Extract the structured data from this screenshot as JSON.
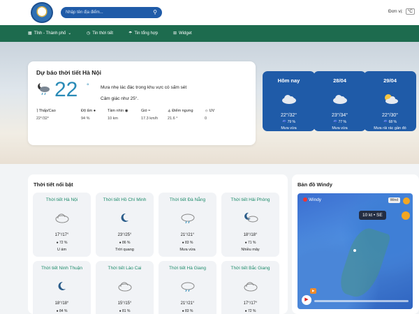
{
  "header": {
    "search_placeholder": "Nhập tên địa điểm...",
    "unit_label": "Đơn vị:",
    "unit_value": "°C"
  },
  "nav": [
    {
      "label": "Tỉnh - Thành phố",
      "icon": "building-icon"
    },
    {
      "label": "Tin thời tiết",
      "icon": "clock-icon"
    },
    {
      "label": "Tin tổng hợp",
      "icon": "umbrella-icon"
    },
    {
      "label": "Widget",
      "icon": "widget-icon"
    }
  ],
  "forecast": {
    "title": "Dự báo thời tiết Hà Nội",
    "temp": "22",
    "unit": "°",
    "desc": "Mưa nhẹ lác đác trong khu vực có sấm sét",
    "feels": "Cảm giác như 25°.",
    "stats": [
      {
        "label": "Thấp/Cao",
        "value": "22°/32°"
      },
      {
        "label": "Độ ẩm",
        "value": "94 %"
      },
      {
        "label": "Tầm nhìn",
        "value": "10 km"
      },
      {
        "label": "Gió",
        "value": "17.3 km/h"
      },
      {
        "label": "Điểm ngưng",
        "value": "21.6 °"
      },
      {
        "label": "UV",
        "value": "0"
      }
    ]
  },
  "days": [
    {
      "label": "Hôm nay",
      "temp": "22°/32°",
      "rain": "☔ 79 %",
      "summary": "Mưa vừa",
      "icon": "cloud-icon"
    },
    {
      "label": "28/04",
      "temp": "23°/34°",
      "rain": "☔ 77 %",
      "summary": "Mưa vừa",
      "icon": "cloud-icon"
    },
    {
      "label": "29/04",
      "temp": "22°/30°",
      "rain": "☔ 68 %",
      "summary": "Mưa rải rác gần đó",
      "icon": "sun-cloud-icon"
    }
  ],
  "featured": {
    "title": "Thời tiết nổi bật",
    "cities": [
      {
        "name": "Thời tiết Hà Nội",
        "temp": "17°/17°",
        "rain": "72 %",
        "summary": "U ám",
        "icon": "cloud-icon"
      },
      {
        "name": "Thời tiết Hồ Chí Minh",
        "temp": "23°/25°",
        "rain": "86 %",
        "summary": "Trời quang",
        "icon": "moon-icon"
      },
      {
        "name": "Thời tiết Đà Nẵng",
        "temp": "21°/21°",
        "rain": "83 %",
        "summary": "Mưa vừa",
        "icon": "rain-cloud-icon"
      },
      {
        "name": "Thời tiết Hải Phòng",
        "temp": "18°/18°",
        "rain": "71 %",
        "summary": "Nhiều mây",
        "icon": "moon-cloud-icon"
      },
      {
        "name": "Thời tiết Ninh Thuận",
        "temp": "18°/18°",
        "rain": "84 %",
        "summary": "",
        "icon": "moon-icon"
      },
      {
        "name": "Thời tiết Lào Cai",
        "temp": "15°/15°",
        "rain": "81 %",
        "summary": "",
        "icon": "cloud-icon"
      },
      {
        "name": "Thời tiết Hà Giang",
        "temp": "21°/21°",
        "rain": "83 %",
        "summary": "",
        "icon": "rain-cloud-icon"
      },
      {
        "name": "Thời tiết Bắc Giang",
        "temp": "17°/17°",
        "rain": "72 %",
        "summary": "",
        "icon": "cloud-icon"
      }
    ]
  },
  "windy": {
    "title": "Bản đồ Windy",
    "brand": "Windy",
    "wind": "10 kt • SE",
    "tag": "Wind"
  }
}
